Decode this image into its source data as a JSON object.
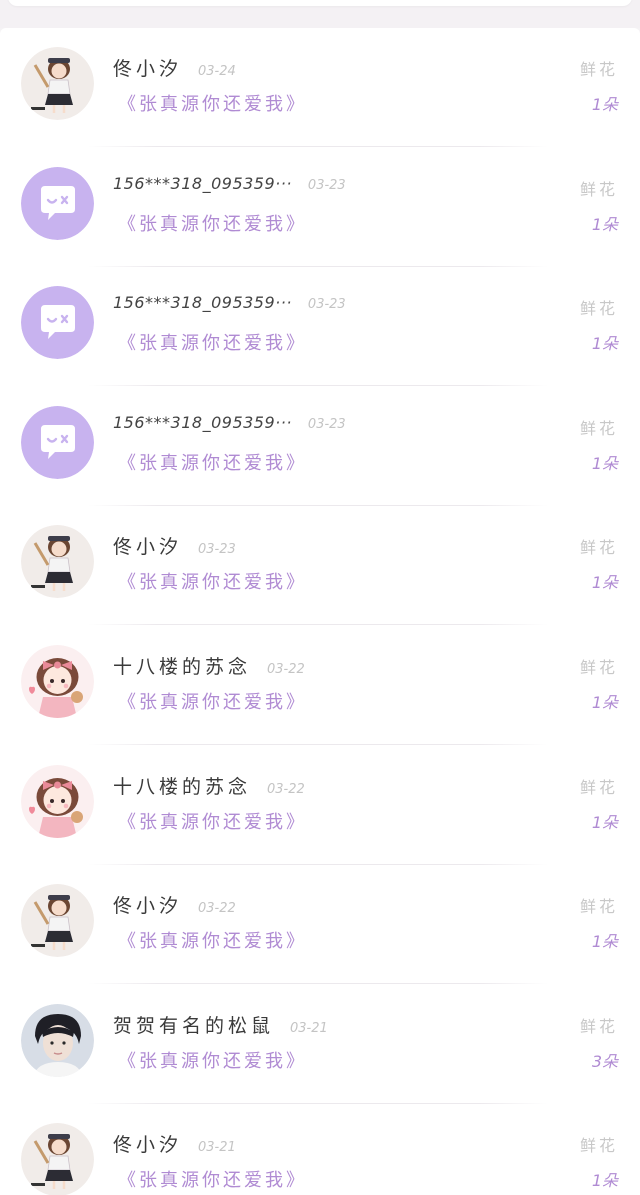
{
  "rows": [
    {
      "avatar": "girl-figure-avatar",
      "name": "佟小汐",
      "name_latin": false,
      "date": "03-24",
      "book": "《张真源你还爱我》",
      "gift_type": "鲜花",
      "gift_count": "1朵"
    },
    {
      "avatar": "purple-chat-bubble-avatar",
      "name": "156***318_095359···",
      "name_latin": true,
      "date": "03-23",
      "book": "《张真源你还爱我》",
      "gift_type": "鲜花",
      "gift_count": "1朵"
    },
    {
      "avatar": "purple-chat-bubble-avatar",
      "name": "156***318_095359···",
      "name_latin": true,
      "date": "03-23",
      "book": "《张真源你还爱我》",
      "gift_type": "鲜花",
      "gift_count": "1朵"
    },
    {
      "avatar": "purple-chat-bubble-avatar",
      "name": "156***318_095359···",
      "name_latin": true,
      "date": "03-23",
      "book": "《张真源你还爱我》",
      "gift_type": "鲜花",
      "gift_count": "1朵"
    },
    {
      "avatar": "girl-figure-avatar",
      "name": "佟小汐",
      "name_latin": false,
      "date": "03-23",
      "book": "《张真源你还爱我》",
      "gift_type": "鲜花",
      "gift_count": "1朵"
    },
    {
      "avatar": "pink-bow-girl-avatar",
      "name": "十八楼的苏念",
      "name_latin": false,
      "date": "03-22",
      "book": "《张真源你还爱我》",
      "gift_type": "鲜花",
      "gift_count": "1朵"
    },
    {
      "avatar": "pink-bow-girl-avatar",
      "name": "十八楼的苏念",
      "name_latin": false,
      "date": "03-22",
      "book": "《张真源你还爱我》",
      "gift_type": "鲜花",
      "gift_count": "1朵"
    },
    {
      "avatar": "girl-figure-avatar",
      "name": "佟小汐",
      "name_latin": false,
      "date": "03-22",
      "book": "《张真源你还爱我》",
      "gift_type": "鲜花",
      "gift_count": "1朵"
    },
    {
      "avatar": "photo-portrait-avatar",
      "name": "贺贺有名的松鼠",
      "name_latin": false,
      "date": "03-21",
      "book": "《张真源你还爱我》",
      "gift_type": "鲜花",
      "gift_count": "3朵"
    },
    {
      "avatar": "girl-figure-avatar",
      "name": "佟小汐",
      "name_latin": false,
      "date": "03-21",
      "book": "《张真源你还爱我》",
      "gift_type": "鲜花",
      "gift_count": "1朵"
    }
  ],
  "colors": {
    "accent_purple": "#b08bd3",
    "avatar_purple": "#c8b3ef",
    "muted_gray": "#c8c8c8",
    "name_text": "#3a3a3a"
  }
}
